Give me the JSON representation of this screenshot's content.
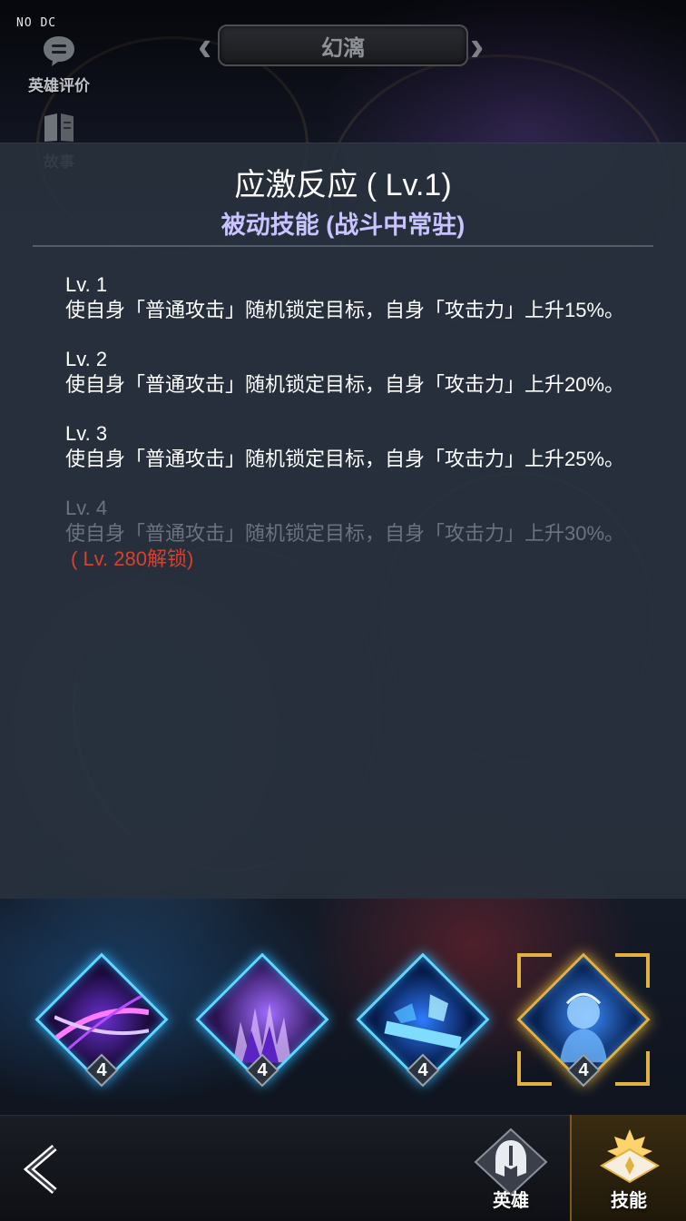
{
  "debug_label": "NO DC",
  "top": {
    "hero_name": "幻漓",
    "hero_rating_label": "英雄评价",
    "story_label": "故事"
  },
  "skill_panel": {
    "title": "应激反应 ( Lv.1)",
    "subtitle": "被动技能 (战斗中常驻)",
    "levels": [
      {
        "title": "Lv. 1",
        "desc": "使自身「普通攻击」随机锁定目标，自身「攻击力」上升15%。",
        "locked": false,
        "unlock": ""
      },
      {
        "title": "Lv. 2",
        "desc": "使自身「普通攻击」随机锁定目标，自身「攻击力」上升20%。",
        "locked": false,
        "unlock": ""
      },
      {
        "title": "Lv. 3",
        "desc": "使自身「普通攻击」随机锁定目标，自身「攻击力」上升25%。",
        "locked": false,
        "unlock": ""
      },
      {
        "title": "Lv. 4",
        "desc": "使自身「普通攻击」随机锁定目标，自身「攻击力」上升30%。",
        "locked": true,
        "unlock": "( Lv. 280解锁)"
      }
    ]
  },
  "skills": [
    {
      "icon": "crossed-slash-icon",
      "level": "4",
      "selected": false
    },
    {
      "icon": "purple-flames-icon",
      "level": "4",
      "selected": false
    },
    {
      "icon": "ice-blade-icon",
      "level": "4",
      "selected": false
    },
    {
      "icon": "hero-portrait-icon",
      "level": "4",
      "selected": true
    }
  ],
  "nav": {
    "hero_label": "英雄",
    "skill_label": "技能",
    "active": "skill"
  },
  "colors": {
    "accent_gold": "#e1b23f",
    "skill_glow": "#5fd8ff",
    "unlock_red": "#d8412b",
    "subtitle_purple": "#c9c3ff"
  }
}
